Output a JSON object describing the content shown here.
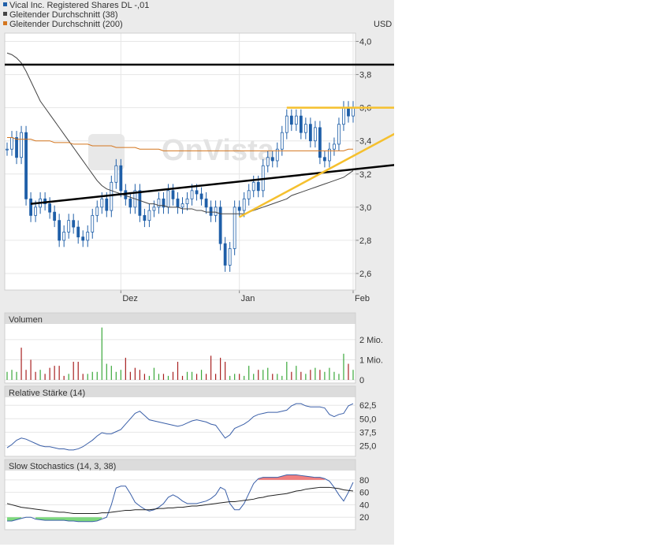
{
  "legend": [
    {
      "label": "Vical Inc. Registered Shares DL -,01",
      "color": "#1f5fa8"
    },
    {
      "label": "Gleitender Durchschnitt (38)",
      "color": "#444444"
    },
    {
      "label": "Gleitender Durchschnitt (200)",
      "color": "#d4761f"
    }
  ],
  "watermark": "OnVista",
  "colors": {
    "candle": "#1f5fa8",
    "ma38": "#444444",
    "ma200": "#d4761f",
    "trend": "#000000",
    "triangle": "#f5c02e",
    "vol_up": "#3aa83a",
    "vol_down": "#a82020",
    "rsi": "#3a5fa8",
    "stoch_fill_high": "#f08080",
    "stoch_fill_low": "#7dd87d"
  },
  "chart_data": [
    {
      "type": "candlestick",
      "title": "Vical Inc. Registered Shares DL -,01",
      "unit": "USD",
      "ylim": [
        2.5,
        4.05
      ],
      "yticks": [
        "4,0",
        "3,8",
        "3,6",
        "3,4",
        "3,2",
        "3,0",
        "2,8",
        "2,6"
      ],
      "ytick_values": [
        4.0,
        3.8,
        3.6,
        3.4,
        3.2,
        3.0,
        2.8,
        2.6
      ],
      "xticks": [
        "Dez",
        "Jan",
        "Feb"
      ],
      "xtick_index": [
        24,
        49,
        73
      ],
      "n": 74,
      "close": [
        3.35,
        3.42,
        3.3,
        3.45,
        3.05,
        2.95,
        3.0,
        3.05,
        3.02,
        2.97,
        2.92,
        2.8,
        2.85,
        2.92,
        2.88,
        2.82,
        2.8,
        2.85,
        2.95,
        3.0,
        3.05,
        2.98,
        3.15,
        3.25,
        3.1,
        3.05,
        3.0,
        3.1,
        2.95,
        2.92,
        2.98,
        3.0,
        3.05,
        3.0,
        3.1,
        3.05,
        3.0,
        3.02,
        3.05,
        3.1,
        3.08,
        3.05,
        3.0,
        2.95,
        3.0,
        2.78,
        2.65,
        2.75,
        3.0,
        2.98,
        3.05,
        3.1,
        3.15,
        3.1,
        3.25,
        3.3,
        3.28,
        3.35,
        3.45,
        3.55,
        3.5,
        3.55,
        3.45,
        3.5,
        3.4,
        3.48,
        3.3,
        3.28,
        3.35,
        3.38,
        3.5,
        3.6,
        3.55,
        3.6
      ],
      "ma38": [
        3.93,
        3.92,
        3.9,
        3.87,
        3.82,
        3.76,
        3.7,
        3.64,
        3.6,
        3.56,
        3.52,
        3.48,
        3.44,
        3.4,
        3.36,
        3.32,
        3.28,
        3.24,
        3.2,
        3.16,
        3.13,
        3.11,
        3.1,
        3.09,
        3.08,
        3.07,
        3.06,
        3.05,
        3.04,
        3.03,
        3.02,
        3.02,
        3.01,
        3.01,
        3.0,
        3.0,
        3.0,
        2.99,
        2.99,
        2.99,
        2.98,
        2.98,
        2.97,
        2.97,
        2.97,
        2.96,
        2.96,
        2.96,
        2.96,
        2.96,
        2.96,
        2.97,
        2.98,
        2.99,
        3.0,
        3.01,
        3.02,
        3.03,
        3.04,
        3.05,
        3.07,
        3.08,
        3.09,
        3.1,
        3.11,
        3.12,
        3.13,
        3.14,
        3.15,
        3.16,
        3.17,
        3.18,
        3.2,
        3.22
      ],
      "ma200": [
        3.42,
        3.42,
        3.41,
        3.41,
        3.41,
        3.41,
        3.4,
        3.4,
        3.4,
        3.4,
        3.39,
        3.39,
        3.39,
        3.39,
        3.38,
        3.38,
        3.38,
        3.38,
        3.37,
        3.37,
        3.37,
        3.37,
        3.37,
        3.36,
        3.36,
        3.36,
        3.36,
        3.36,
        3.35,
        3.35,
        3.35,
        3.35,
        3.35,
        3.34,
        3.34,
        3.34,
        3.34,
        3.34,
        3.34,
        3.34,
        3.34,
        3.34,
        3.34,
        3.34,
        3.34,
        3.34,
        3.34,
        3.34,
        3.34,
        3.34,
        3.34,
        3.34,
        3.34,
        3.34,
        3.34,
        3.34,
        3.34,
        3.34,
        3.34,
        3.34,
        3.34,
        3.34,
        3.34,
        3.34,
        3.34,
        3.34,
        3.34,
        3.34,
        3.34,
        3.34,
        3.34,
        3.34,
        3.35,
        3.35
      ],
      "annotations": [
        {
          "type": "hline",
          "y": 3.86,
          "color": "#000000"
        },
        {
          "type": "trendline",
          "from": {
            "i": 5,
            "y": 3.02
          },
          "to": {
            "i": 90,
            "y": 3.28
          },
          "color": "#000000"
        },
        {
          "type": "trendline",
          "from": {
            "i": 49,
            "y": 2.94
          },
          "to": {
            "i": 92,
            "y": 3.6
          },
          "color": "#f5c02e"
        },
        {
          "type": "hline",
          "from_i": 59,
          "to_i": 92,
          "y": 3.6,
          "color": "#f5c02e"
        }
      ]
    },
    {
      "type": "bar",
      "title": "Volumen",
      "yticks": [
        "2 Mio.",
        "1 Mio.",
        "0"
      ],
      "ytick_values": [
        2000000,
        1000000,
        0
      ],
      "ylim": [
        0,
        2700000
      ],
      "values": [
        400000,
        500000,
        400000,
        1600000,
        500000,
        1000000,
        400000,
        500000,
        300000,
        600000,
        700000,
        700000,
        200000,
        300000,
        900000,
        900000,
        300000,
        300000,
        400000,
        400000,
        2600000,
        800000,
        700000,
        400000,
        500000,
        1100000,
        400000,
        600000,
        500000,
        300000,
        200000,
        600000,
        300000,
        300000,
        200000,
        400000,
        900000,
        200000,
        400000,
        400000,
        300000,
        500000,
        300000,
        1200000,
        300000,
        1100000,
        900000,
        200000,
        300000,
        300000,
        200000,
        700000,
        300000,
        500000,
        500000,
        600000,
        300000,
        300000,
        200000,
        900000,
        400000,
        700000,
        400000,
        300000,
        500000,
        600000,
        500000,
        400000,
        600000,
        400000,
        300000,
        1300000,
        800000,
        500000
      ],
      "up": [
        true,
        true,
        true,
        false,
        false,
        false,
        false,
        true,
        false,
        false,
        false,
        false,
        false,
        true,
        false,
        false,
        false,
        true,
        true,
        true,
        true,
        true,
        true,
        true,
        true,
        false,
        false,
        false,
        false,
        false,
        true,
        true,
        true,
        false,
        true,
        false,
        false,
        false,
        true,
        true,
        false,
        true,
        false,
        false,
        false,
        false,
        false,
        true,
        true,
        false,
        true,
        true,
        true,
        false,
        true,
        true,
        false,
        true,
        true,
        true,
        false,
        true,
        false,
        true,
        false,
        true,
        false,
        true,
        true,
        true,
        true,
        true,
        false,
        true
      ]
    },
    {
      "type": "line",
      "title": "Relative Stärke (14)",
      "yticks": [
        "62,5",
        "50,0",
        "37,5",
        "25,0"
      ],
      "ytick_values": [
        62.5,
        50.0,
        37.5,
        25.0
      ],
      "ylim": [
        15,
        70
      ],
      "values": [
        23,
        26,
        30,
        32,
        31,
        29,
        27,
        25,
        24,
        24,
        23,
        22,
        22,
        21,
        21,
        22,
        24,
        27,
        30,
        34,
        37,
        36,
        36,
        38,
        40,
        45,
        50,
        55,
        57,
        53,
        49,
        48,
        47,
        46,
        45,
        44,
        43,
        44,
        46,
        48,
        49,
        48,
        47,
        45,
        44,
        38,
        32,
        35,
        41,
        43,
        45,
        48,
        52,
        54,
        55,
        56,
        56,
        56,
        57,
        58,
        62,
        64,
        64,
        62,
        61,
        61,
        61,
        60,
        54,
        52,
        54,
        55,
        62,
        64
      ]
    },
    {
      "type": "line",
      "title": "Slow Stochastics (14, 3, 38)",
      "yticks": [
        "80",
        "60",
        "40",
        "20"
      ],
      "ytick_values": [
        80,
        60,
        40,
        20
      ],
      "ylim": [
        0,
        95
      ],
      "k": [
        14,
        14,
        16,
        18,
        20,
        20,
        17,
        16,
        15,
        15,
        15,
        15,
        15,
        14,
        14,
        13,
        13,
        13,
        13,
        14,
        17,
        20,
        40,
        67,
        70,
        70,
        58,
        44,
        38,
        33,
        30,
        32,
        36,
        42,
        52,
        56,
        52,
        46,
        42,
        42,
        42,
        44,
        46,
        50,
        56,
        68,
        64,
        42,
        32,
        32,
        42,
        58,
        74,
        82,
        84,
        84,
        84,
        84,
        86,
        88,
        88,
        88,
        87,
        86,
        85,
        84,
        84,
        82,
        78,
        68,
        56,
        46,
        60,
        76
      ],
      "d": [
        42,
        40,
        38,
        36,
        35,
        34,
        33,
        32,
        31,
        30,
        29,
        28,
        28,
        27,
        26,
        26,
        26,
        26,
        26,
        26,
        27,
        27,
        28,
        29,
        30,
        31,
        31,
        32,
        32,
        32,
        32,
        33,
        34,
        34,
        35,
        35,
        36,
        36,
        37,
        38,
        38,
        39,
        40,
        41,
        42,
        43,
        44,
        45,
        45,
        46,
        47,
        48,
        49,
        51,
        52,
        54,
        55,
        56,
        57,
        58,
        60,
        62,
        63,
        65,
        66,
        67,
        68,
        68,
        68,
        67,
        66,
        64,
        63,
        62
      ],
      "threshold_high": 80,
      "threshold_low": 20
    }
  ]
}
